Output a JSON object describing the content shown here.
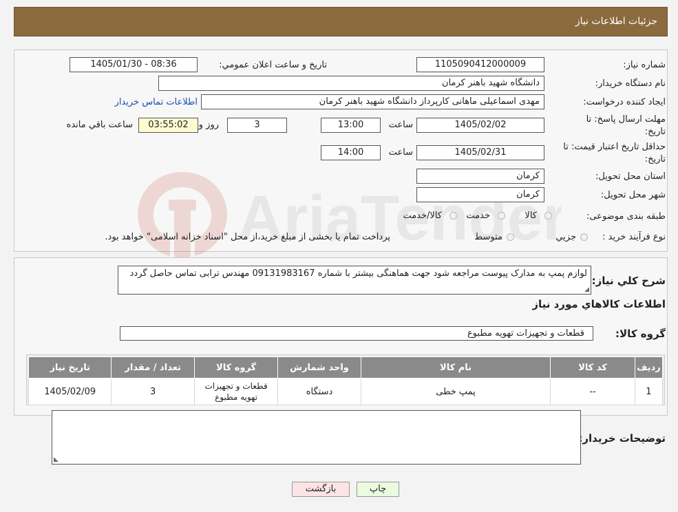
{
  "header": {
    "title": "جزئیات اطلاعات نیاز"
  },
  "form": {
    "need_number_label": "شماره نیاز:",
    "need_number": "1105090412000009",
    "announce_label": "تاریخ و ساعت اعلان عمومي:",
    "announce_value": "1405/01/30 - 08:36",
    "buyer_org_label": "نام دستگاه خریدار:",
    "buyer_org": "دانشگاه شهید باهنر کرمان",
    "creator_label": "ایجاد کننده درخواست:",
    "creator": "مهدی اسماعیلی ماهانی  کارپرداز دانشگاه شهید باهنر کرمان",
    "contact_link": "اطلاعات تماس خریدار",
    "deadline_label_1": "مهلت ارسال پاسخ: تا",
    "deadline_label_2": "تاریخ:",
    "deadline_date": "1405/02/02",
    "time_label": "ساعت",
    "deadline_time": "13:00",
    "days": "3",
    "days_label": "روز و",
    "remaining": "03:55:02",
    "remaining_label": "ساعت باقي مانده",
    "validity_label_1": "حداقل تاریخ اعتبار قیمت: تا",
    "validity_label_2": "تاریخ:",
    "validity_date": "1405/02/31",
    "validity_time": "14:00",
    "province_label": "استان محل تحویل:",
    "province": "کرمان",
    "city_label": "شهر محل تحویل:",
    "city": "کرمان",
    "category_label": "طبقه بندی موضوعی:",
    "category_options": [
      "کالا",
      "خدمت",
      "کالا/خدمت"
    ],
    "process_label": "نوع فرآیند خرید :",
    "process_options": [
      "جزیي",
      "متوسط"
    ],
    "process_note": "پرداخت تمام یا بخشی از مبلغ خرید،از محل \"اسناد خزانه اسلامی\" خواهد بود."
  },
  "watermark": {
    "text": "AriaTender.neT"
  },
  "details": {
    "description_label": "شرح کلي نیاز:",
    "description": "لوازم پمپ به مدارک پیوست مراجعه شود جهت هماهنگی بیشتر با شماره 09131983167 مهندس ترابی تماس حاصل گردد",
    "goods_info_title": "اطلاعات کالاهاي مورد نیاز",
    "goods_group_label": "گروه کالا:",
    "goods_group": "قطعات و تجهیزات تهویه مطبوع"
  },
  "table": {
    "headers": [
      "ردیف",
      "کد کالا",
      "نام کالا",
      "واحد شمارش",
      "گروه کالا",
      "تعداد / مقدار",
      "تاریخ نیاز"
    ],
    "rows": [
      [
        "1",
        "--",
        "پمپ خطی",
        "دستگاه",
        "قطعات و تجهیزات تهویه مطبوع",
        "3",
        "1405/02/09"
      ]
    ]
  },
  "buyer_notes": {
    "label": "توضیحات خریدار:",
    "value": ""
  },
  "buttons": {
    "print": "چاپ",
    "back": "بازگشت"
  },
  "colors": {
    "header_bg": "#8b6a3e",
    "remaining_bg": "#fffbd0",
    "print_bg": "#eafbe0",
    "back_bg": "#fde4e4"
  }
}
